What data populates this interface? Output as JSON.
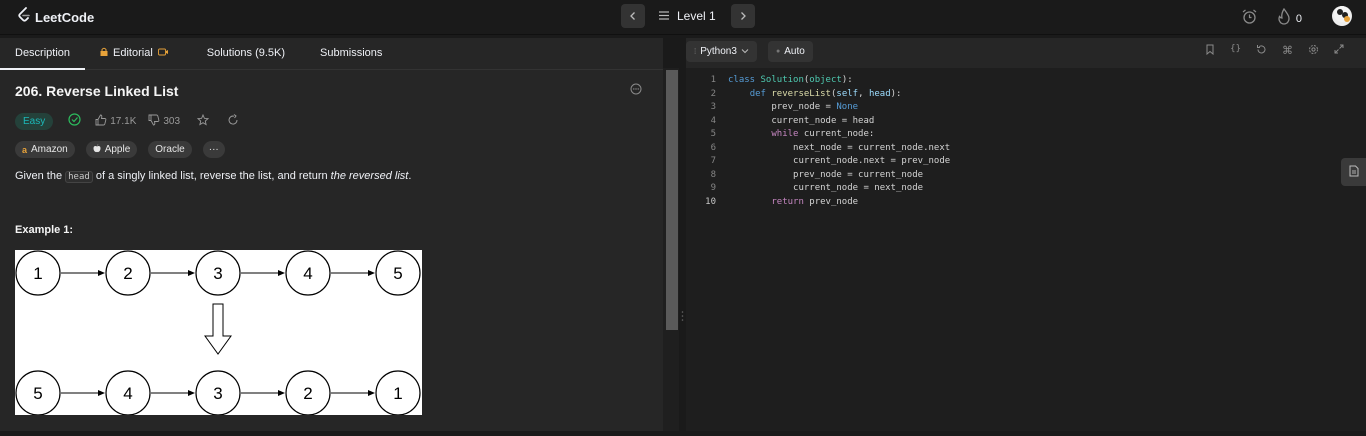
{
  "topbar": {
    "logo_text": "LeetCode",
    "level_label": "Level 1",
    "streak_count": "0"
  },
  "left": {
    "tabs": [
      {
        "label": "Description"
      },
      {
        "label": "Editorial"
      },
      {
        "label": "Solutions (9.5K)"
      },
      {
        "label": "Submissions"
      }
    ],
    "problem_title": "206. Reverse Linked List",
    "difficulty": "Easy",
    "likes": "17.1K",
    "dislikes": "303",
    "companies": [
      "Amazon",
      "Apple",
      "Oracle"
    ],
    "more_label": "···",
    "desc_before": "Given the ",
    "desc_code": "head",
    "desc_middle": " of a singly linked list, reverse the list, and return ",
    "desc_em": "the reversed list",
    "desc_end": ".",
    "example_title": "Example 1:",
    "diagram": {
      "top_nodes": [
        "1",
        "2",
        "3",
        "4",
        "5"
      ],
      "bottom_nodes": [
        "5",
        "4",
        "3",
        "2",
        "1"
      ]
    }
  },
  "editor": {
    "language": "Python3",
    "mode": "Auto",
    "lines": [
      "class Solution(object):",
      "    def reverseList(self, head):",
      "        prev_node = None",
      "        current_node = head",
      "        while current_node:",
      "            next_node = current_node.next",
      "            current_node.next = prev_node",
      "            prev_node = current_node",
      "            current_node = next_node",
      "        return prev_node"
    ],
    "line_numbers": [
      "1",
      "2",
      "3",
      "4",
      "5",
      "6",
      "7",
      "8",
      "9",
      "10"
    ]
  },
  "colors": {
    "easy_text": "#1cb8b8",
    "background": "#1a1a1a"
  }
}
